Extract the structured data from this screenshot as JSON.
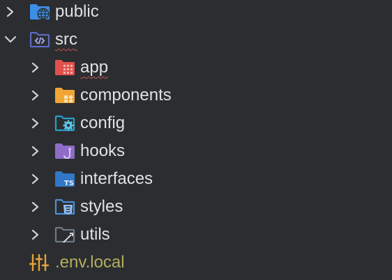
{
  "tree": {
    "items": [
      {
        "label": "public",
        "icon": "folder-web-icon",
        "expanded": false,
        "depth": 0,
        "color": "#3d8ee6"
      },
      {
        "label": "src",
        "icon": "folder-source-icon",
        "expanded": true,
        "depth": 0,
        "color": "#5c6bc0"
      },
      {
        "label": "app",
        "icon": "folder-app-icon",
        "expanded": false,
        "depth": 1,
        "color": "#e2504c"
      },
      {
        "label": "components",
        "icon": "folder-components-icon",
        "expanded": false,
        "depth": 1,
        "color": "#f0a534"
      },
      {
        "label": "config",
        "icon": "folder-config-icon",
        "expanded": false,
        "depth": 1,
        "color": "#26a0c8"
      },
      {
        "label": "hooks",
        "icon": "folder-hooks-icon",
        "expanded": false,
        "depth": 1,
        "color": "#8e6cc8"
      },
      {
        "label": "interfaces",
        "icon": "folder-typescript-icon",
        "expanded": false,
        "depth": 1,
        "color": "#3178c6"
      },
      {
        "label": "styles",
        "icon": "folder-css-icon",
        "expanded": false,
        "depth": 1,
        "color": "#4b8fd8"
      },
      {
        "label": "utils",
        "icon": "folder-utils-icon",
        "expanded": false,
        "depth": 1,
        "color": "#6c7a86"
      },
      {
        "label": ".env.local",
        "icon": "env-settings-icon",
        "expanded": false,
        "depth": 1,
        "color": "#e8a33a"
      }
    ]
  },
  "colors": {
    "background": "#2b2d30",
    "text": "#dfe1e5",
    "env_text": "#b3ae60",
    "chevron": "#cfd1d4",
    "error_underline": "#c75450"
  }
}
